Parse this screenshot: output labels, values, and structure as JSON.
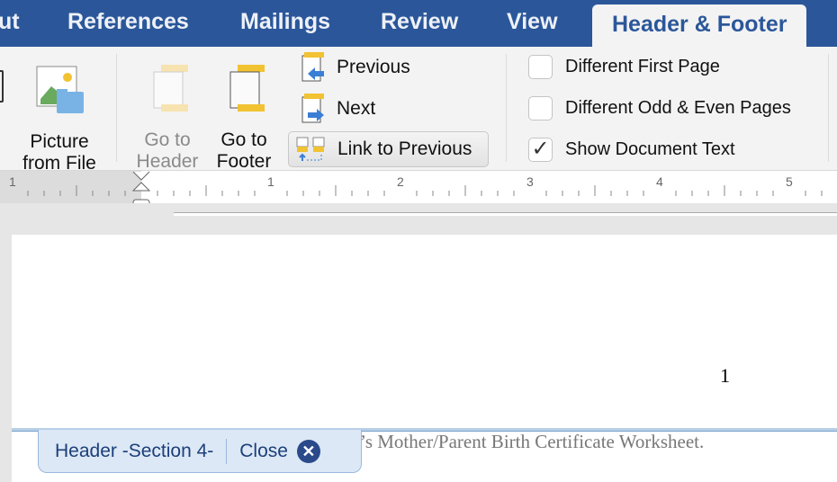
{
  "tabs": [
    {
      "label": "ut"
    },
    {
      "label": "References"
    },
    {
      "label": "Mailings"
    },
    {
      "label": "Review"
    },
    {
      "label": "View"
    },
    {
      "label": "Header & Footer",
      "active": true
    }
  ],
  "ribbon": {
    "picture": {
      "line1": "Picture",
      "line2": "from File"
    },
    "go_header": {
      "line1": "Go to",
      "line2": "Header",
      "disabled": true
    },
    "go_footer": {
      "line1": "Go to",
      "line2": "Footer"
    },
    "previous": "Previous",
    "next": "Next",
    "link_previous": "Link to Previous",
    "options": [
      {
        "label": "Different First Page",
        "checked": false
      },
      {
        "label": "Different Odd & Even Pages",
        "checked": false
      },
      {
        "label": "Show Document Text",
        "checked": true
      }
    ]
  },
  "ruler": {
    "labels": [
      "1",
      "1",
      "2",
      "3",
      "4",
      "5"
    ]
  },
  "document": {
    "page_number": "1",
    "body_text": "’s Mother/Parent Birth Certificate Worksheet."
  },
  "header_tag": {
    "label": "Header -Section 4-",
    "close": "Close"
  },
  "colors": {
    "accent": "#2b579a",
    "header_tag_bg": "#dce8f5"
  }
}
